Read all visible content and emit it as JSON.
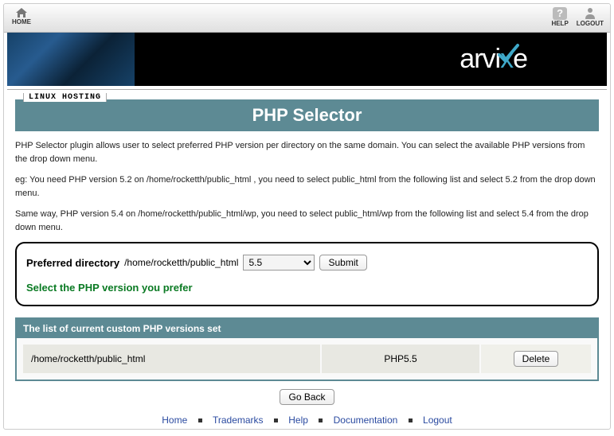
{
  "topbar": {
    "home": "HOME",
    "help": "HELP",
    "logout": "LOGOUT"
  },
  "hosting_label": "LINUX HOSTING",
  "brand": {
    "text_a": "arvi",
    "text_b": "e"
  },
  "page_title": "PHP Selector",
  "description": {
    "p1": "PHP Selector plugin allows user to select preferred PHP version per directory on the same domain. You can select the available PHP versions from the drop down menu.",
    "p2": "eg: You need PHP version 5.2 on /home/rocketth/public_html , you need to select public_html from the following list and select 5.2 from the drop down menu.",
    "p3": "Same way, PHP version 5.4 on /home/rocketth/public_html/wp, you need to select public_html/wp from the following list and select 5.4 from the drop down menu."
  },
  "form": {
    "label": "Preferred directory",
    "path": "/home/rocketth/public_html",
    "selected_version": "5.5",
    "submit": "Submit",
    "prefer_text": "Select the PHP version you prefer"
  },
  "table": {
    "heading": "The list of current custom PHP versions set",
    "rows": [
      {
        "dir": "/home/rocketth/public_html",
        "ver": "PHP5.5",
        "action": "Delete"
      }
    ]
  },
  "goback": "Go Back",
  "footer": {
    "home": "Home",
    "trademarks": "Trademarks",
    "help": "Help",
    "docs": "Documentation",
    "logout": "Logout"
  }
}
